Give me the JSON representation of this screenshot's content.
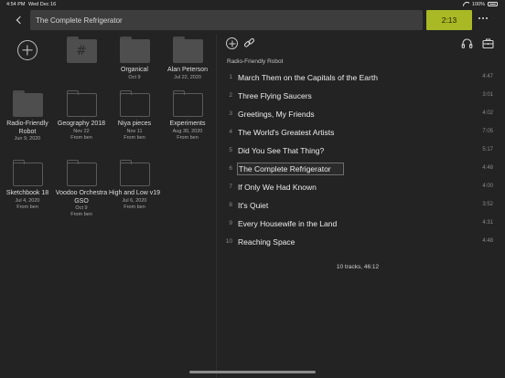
{
  "status_bar": {
    "time": "4:54 PM",
    "date": "Wed Dec 16",
    "battery": "100%"
  },
  "header": {
    "title": "The Complete Refrigerator",
    "timer": "2:13"
  },
  "folders": [
    {
      "name": "",
      "kind": "new",
      "icon": "plus-circle-icon"
    },
    {
      "name": "",
      "kind": "tag",
      "icon": "hash-folder-icon"
    },
    {
      "name": "Organical",
      "date": "Oct 9",
      "owner": ""
    },
    {
      "name": "Alan Peterson",
      "date": "Jul 22, 2020",
      "owner": ""
    },
    {
      "name": "Radio-Friendly Robot",
      "date": "Jun 9, 2020",
      "owner": ""
    },
    {
      "name": "Geography 2018",
      "date": "Nov 22",
      "owner": "From ben"
    },
    {
      "name": "Niya pieces",
      "date": "Nov 11",
      "owner": "From ben"
    },
    {
      "name": "Experiments",
      "date": "Aug 30, 2020",
      "owner": "From ben"
    },
    {
      "name": "Sketchbook 18",
      "date": "Jul 4, 2020",
      "owner": "From ben"
    },
    {
      "name": "Voodoo Orchestra GSO",
      "date": "Oct 9",
      "owner": "From ben"
    },
    {
      "name": "High and Low v19",
      "date": "Jul 6, 2020",
      "owner": "From ben"
    }
  ],
  "album": {
    "title": "Radio-Friendly Robot",
    "current_track": 6,
    "tracks": [
      {
        "num": "1",
        "title": "March Them on the Capitals of the Earth",
        "duration": "4:47"
      },
      {
        "num": "2",
        "title": "Three Flying Saucers",
        "duration": "3:01"
      },
      {
        "num": "3",
        "title": "Greetings, My Friends",
        "duration": "4:02"
      },
      {
        "num": "4",
        "title": "The World's Greatest Artists",
        "duration": "7:05"
      },
      {
        "num": "5",
        "title": "Did You See That Thing?",
        "duration": "5:17"
      },
      {
        "num": "6",
        "title": "The Complete Refrigerator",
        "duration": "4:48"
      },
      {
        "num": "7",
        "title": "If Only We Had Known",
        "duration": "4:00"
      },
      {
        "num": "8",
        "title": "It's Quiet",
        "duration": "3:52"
      },
      {
        "num": "9",
        "title": "Every Housewife in the Land",
        "duration": "4:31"
      },
      {
        "num": "10",
        "title": "Reaching Space",
        "duration": "4:48"
      }
    ],
    "summary": "10 tracks, 46:12"
  },
  "toolbar_icons": [
    "add-circle-icon",
    "link-icon",
    "headphones-icon",
    "briefcase-icon"
  ],
  "colors": {
    "background": "#232323",
    "accent": "#a9b825",
    "field": "#3d3d3d"
  }
}
